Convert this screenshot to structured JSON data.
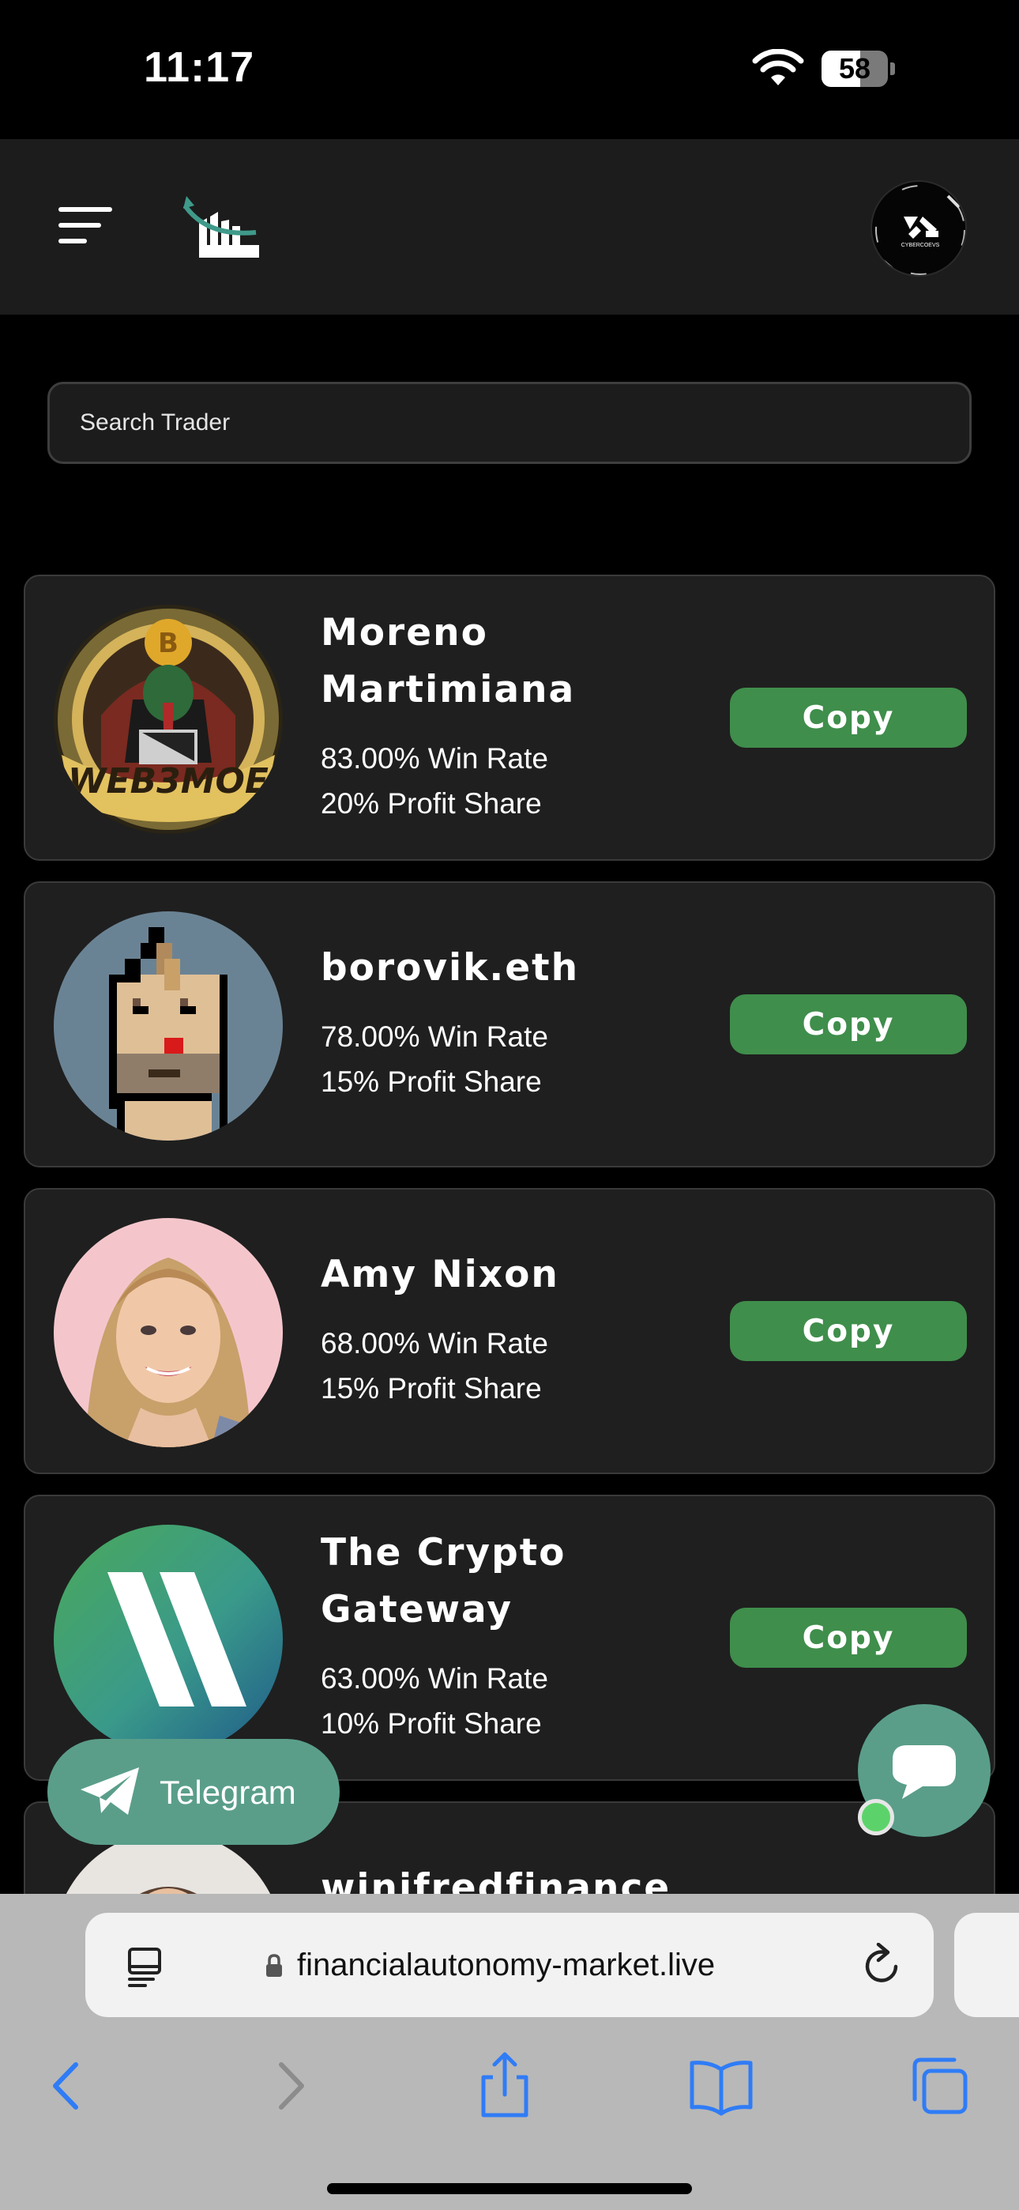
{
  "status_bar": {
    "time": "11:17",
    "battery_level": "58",
    "battery_fraction": 0.58
  },
  "header": {
    "menu_icon": "hamburger-menu-icon",
    "logo_icon": "chart-arrow-logo-icon",
    "avatar_icon": "account-avatar-icon"
  },
  "search": {
    "placeholder": "Search Trader"
  },
  "traders": [
    {
      "name": "Moreno Martimiana",
      "win_rate": "83.00% Win Rate",
      "profit_share": "20% Profit Share",
      "button": "Copy",
      "avatar_text": "WEB3MOE"
    },
    {
      "name": "borovik.eth",
      "win_rate": "78.00% Win Rate",
      "profit_share": "15% Profit Share",
      "button": "Copy"
    },
    {
      "name": "Amy Nixon",
      "win_rate": "68.00% Win Rate",
      "profit_share": "15% Profit Share",
      "button": "Copy"
    },
    {
      "name": "The Crypto Gateway",
      "win_rate": "63.00% Win Rate",
      "profit_share": "10% Profit Share",
      "button": "Copy"
    },
    {
      "name": "winifredfinance"
    }
  ],
  "floating": {
    "telegram_label": "Telegram",
    "chat_icon": "chat-bubble-icon"
  },
  "browser": {
    "url": "financialautonomy-market.live",
    "toolbar_icons": [
      "back-icon",
      "forward-icon",
      "share-icon",
      "bookmarks-icon",
      "tabs-icon"
    ]
  },
  "colors": {
    "accent_green": "#3f8e4b",
    "teal": "#5a9e8a",
    "card_bg": "#1f1f1f",
    "safari_blue": "#2f7cf6"
  }
}
